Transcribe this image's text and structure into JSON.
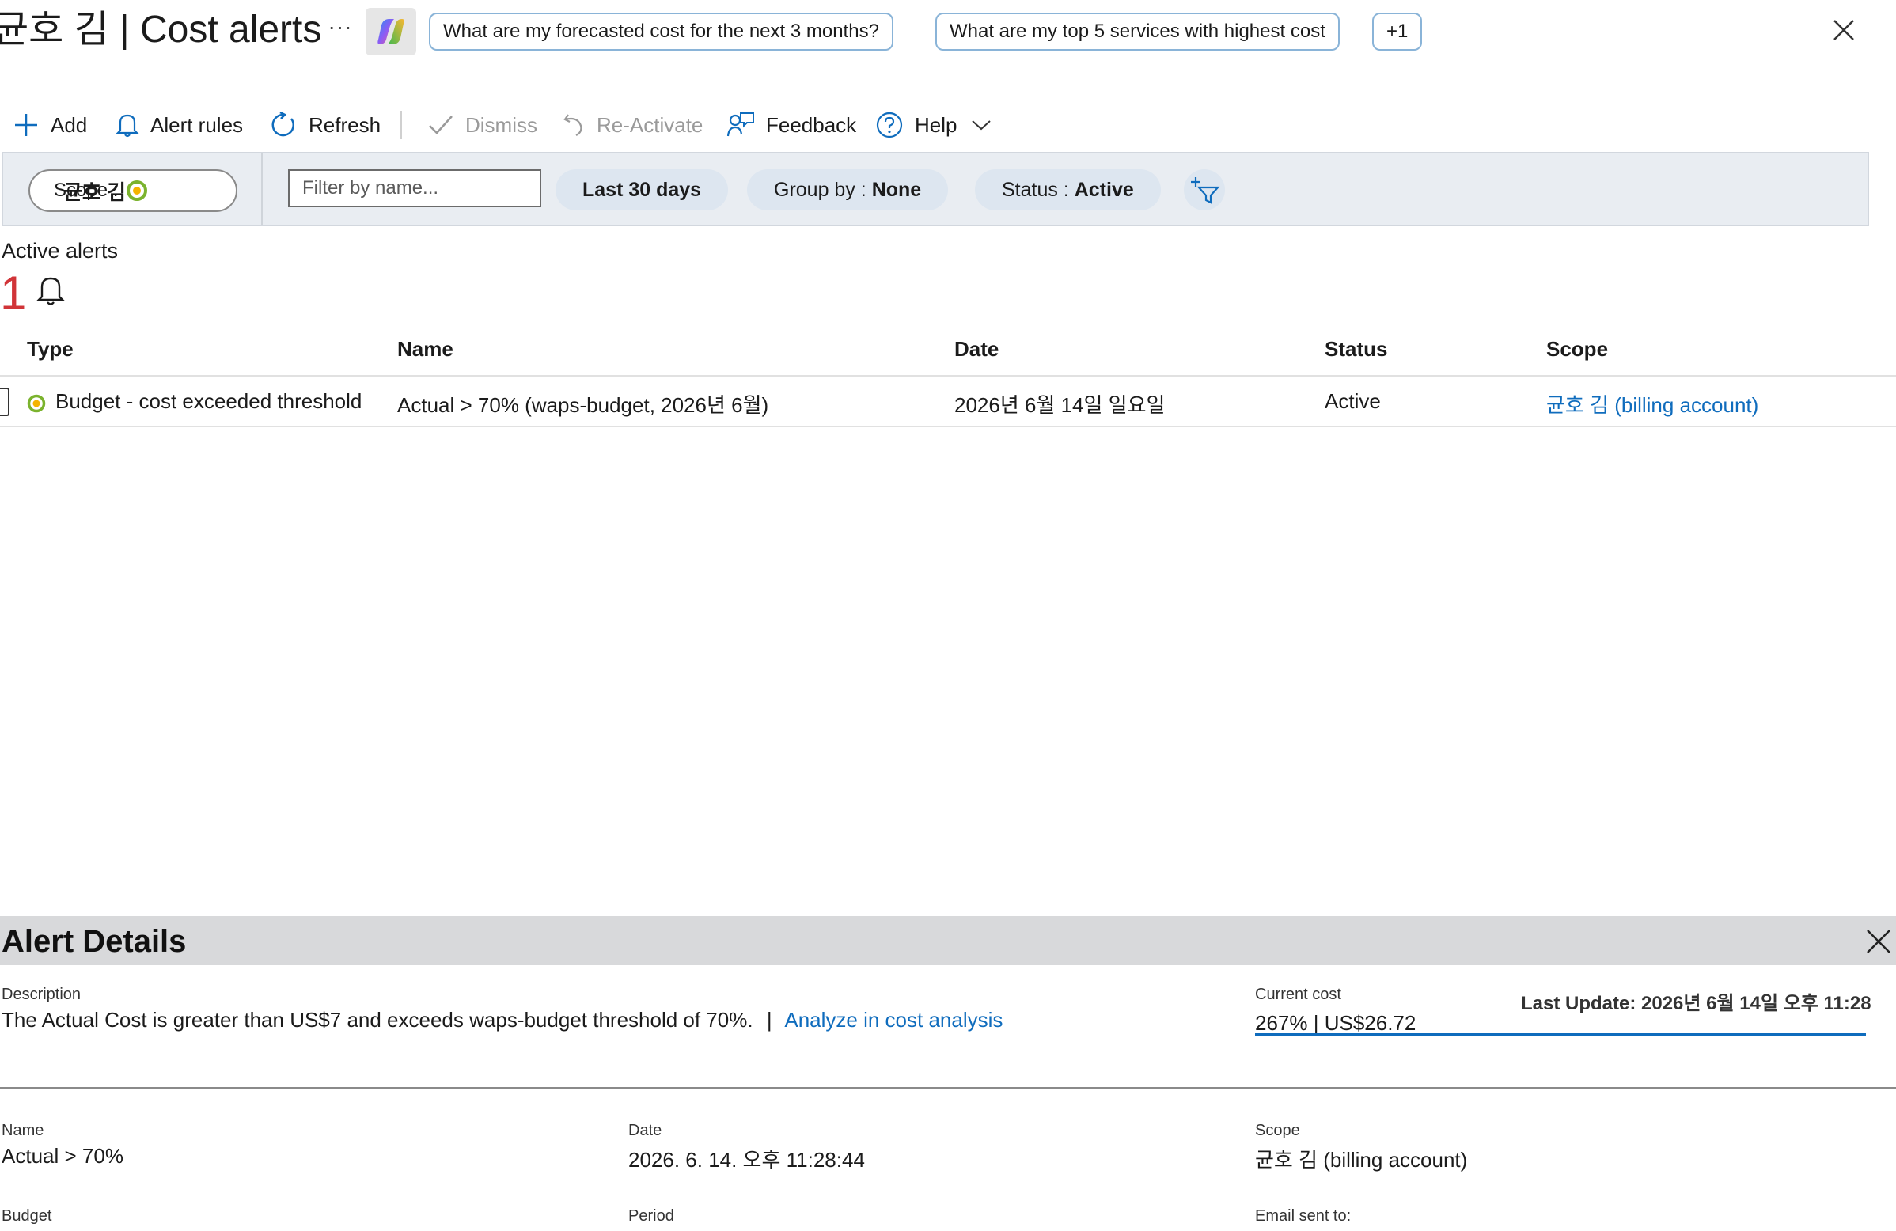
{
  "header": {
    "title": "균호 김 | Cost alerts",
    "more_label": "···",
    "suggestions": [
      "What are my forecasted cost for the next 3 months?",
      "What are my top 5 services with highest cost",
      "+1"
    ]
  },
  "toolbar": {
    "add": "Add",
    "alert_rules": "Alert rules",
    "refresh": "Refresh",
    "dismiss": "Dismiss",
    "reactivate": "Re-Activate",
    "feedback": "Feedback",
    "help": "Help"
  },
  "filters": {
    "scope_label": "Scope :",
    "scope_value": "균호 김",
    "search_placeholder": "Filter by name...",
    "date_range": "Last 30 days",
    "group_by_label": "Group by :",
    "group_by_value": "None",
    "status_label": "Status :",
    "status_value": "Active"
  },
  "summary": {
    "label": "Active alerts",
    "count": "1"
  },
  "table": {
    "columns": [
      "Type",
      "Name",
      "Date",
      "Status",
      "Scope"
    ],
    "rows": [
      {
        "type": "Budget - cost exceeded threshold",
        "name": "Actual > 70% (waps-budget, 2026년 6월)",
        "date": "2026년 6월 14일 일요일",
        "status": "Active",
        "scope": "균호 김 (billing account)"
      }
    ]
  },
  "details": {
    "title": "Alert Details",
    "description_label": "Description",
    "description": "The Actual Cost is greater than US$7 and exceeds waps-budget threshold of 70%.",
    "separator": "|",
    "analyze_link": "Analyze in cost analysis",
    "current_cost_label": "Current cost",
    "current_cost": "267% | US$26.72",
    "last_update": "Last Update: 2026년 6월 14일 오후 11:28",
    "name_label": "Name",
    "name": "Actual > 70%",
    "date_label": "Date",
    "date": "2026. 6. 14. 오후 11:28:44",
    "scope_label": "Scope",
    "scope": "균호 김 (billing account)",
    "budget_label": "Budget",
    "period_label": "Period",
    "email_label": "Email sent to:"
  },
  "colors": {
    "accent": "#0f6cbd",
    "alert_count": "#d13438",
    "filter_bg": "#e9edf2",
    "pill_bg": "#dde6f0",
    "details_header_bg": "#d8d9db"
  }
}
